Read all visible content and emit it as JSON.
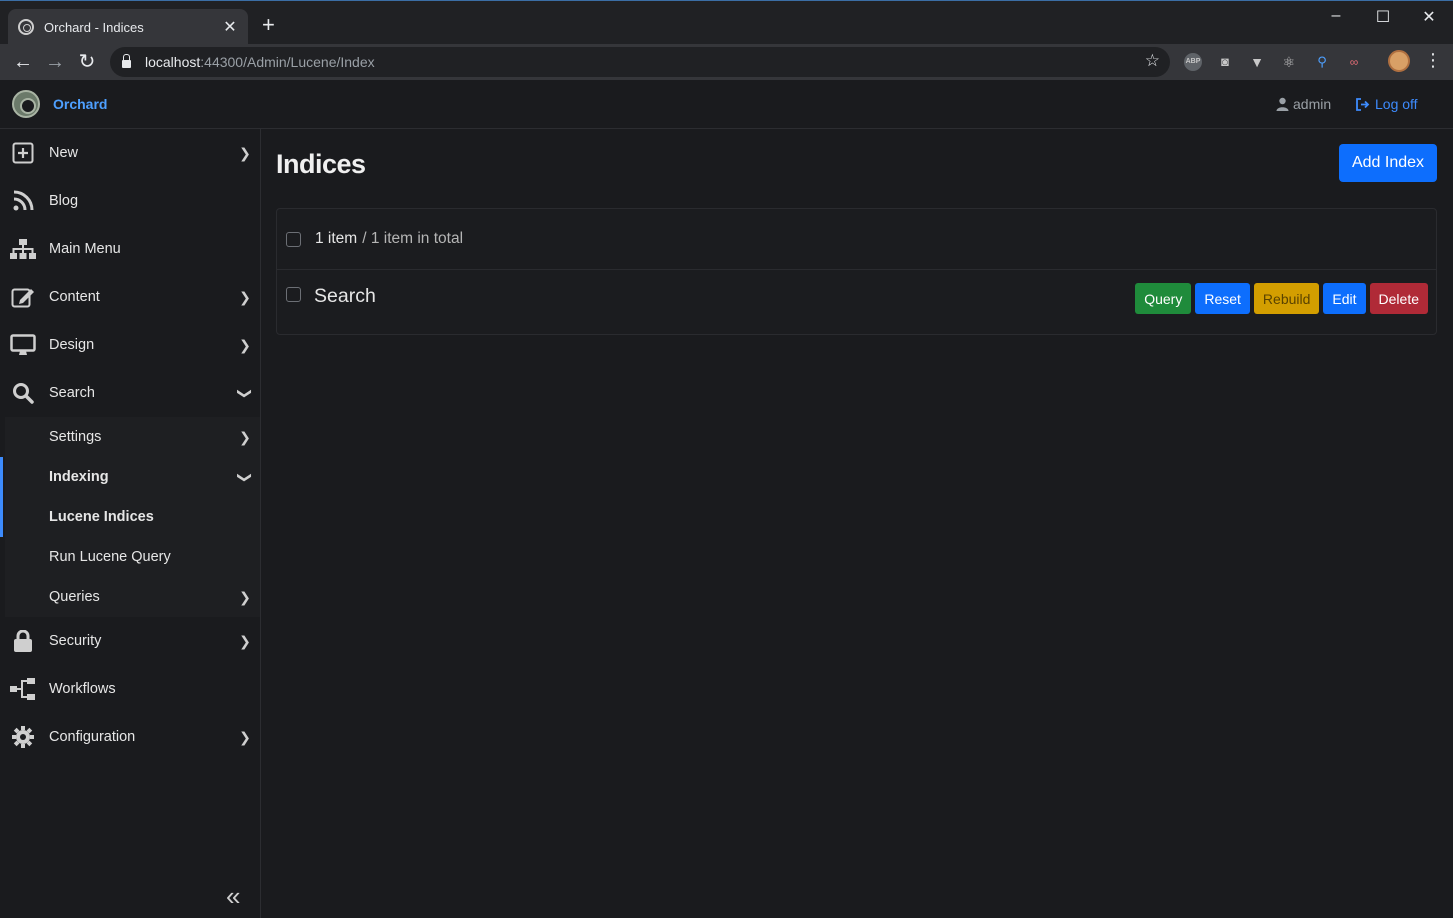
{
  "browser": {
    "tab_title": "Orchard - Indices",
    "url_host": "localhost",
    "url_rest": ":44300/Admin/Lucene/Index"
  },
  "navbar": {
    "brand": "Orchard",
    "user": "admin",
    "logoff": "Log off"
  },
  "sidebar": {
    "items": [
      {
        "label": "New"
      },
      {
        "label": "Blog"
      },
      {
        "label": "Main Menu"
      },
      {
        "label": "Content"
      },
      {
        "label": "Design"
      },
      {
        "label": "Search"
      },
      {
        "label": "Security"
      },
      {
        "label": "Workflows"
      },
      {
        "label": "Configuration"
      }
    ],
    "search_sub": [
      {
        "label": "Settings"
      },
      {
        "label": "Indexing"
      },
      {
        "label": "Lucene Indices"
      },
      {
        "label": "Run Lucene Query"
      },
      {
        "label": "Queries"
      }
    ]
  },
  "main": {
    "title": "Indices",
    "add_button": "Add Index",
    "summary_count": "1 item",
    "summary_total": "/ 1 item in total",
    "rows": [
      {
        "name": "Search",
        "actions": {
          "query": "Query",
          "reset": "Reset",
          "rebuild": "Rebuild",
          "edit": "Edit",
          "delete": "Delete"
        }
      }
    ]
  },
  "colors": {
    "primary": "#0d6efd",
    "success": "#1f8b3b",
    "warning": "#d39e00",
    "danger": "#b02a37",
    "link": "#3d8bfd"
  }
}
